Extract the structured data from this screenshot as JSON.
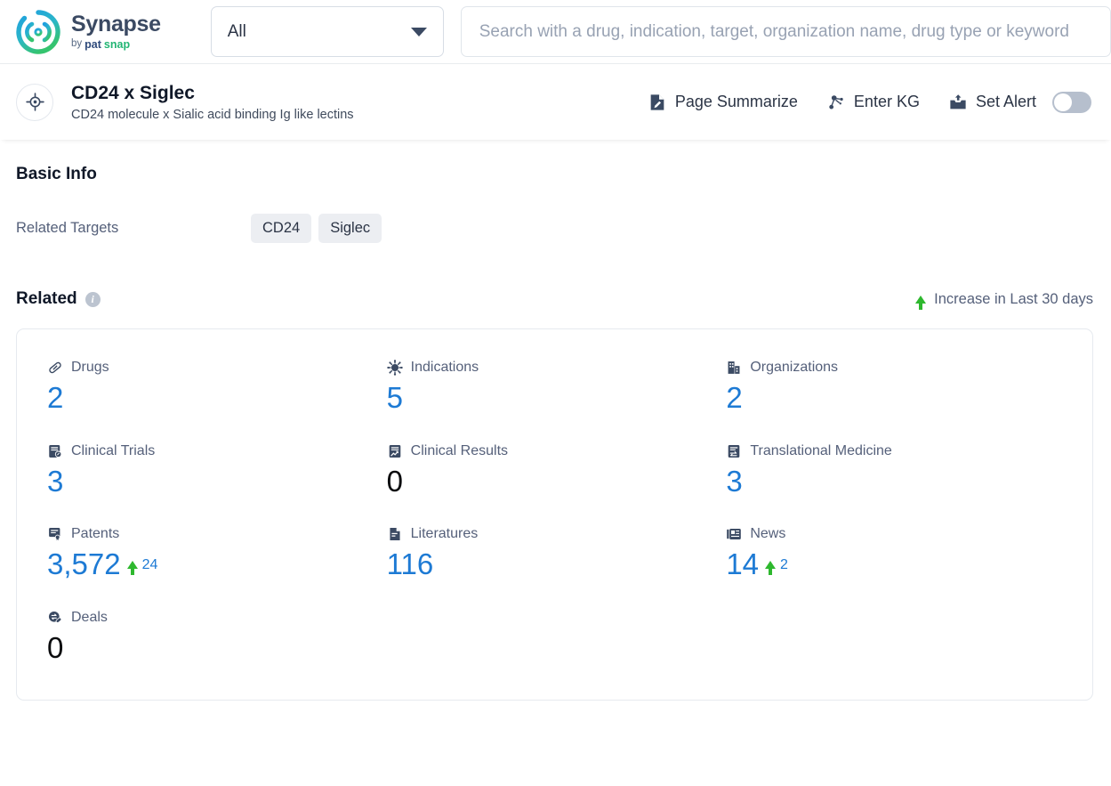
{
  "header": {
    "brand_name": "Synapse",
    "brand_by": "by",
    "brand_pat": "pat",
    "brand_snap": "snap",
    "scope_value": "All",
    "search_placeholder": "Search with a drug, indication, target, organization name, drug type or keyword",
    "search_value": ""
  },
  "entity": {
    "title": "CD24 x Siglec",
    "subtitle": "CD24 molecule x Sialic acid binding Ig like lectins",
    "icon": "target-icon"
  },
  "actions": [
    {
      "label": "Page Summarize",
      "icon": "page-summarize-icon"
    },
    {
      "label": "Enter KG",
      "icon": "knowledge-graph-icon"
    },
    {
      "label": "Set Alert",
      "icon": "alert-inbox-icon",
      "toggle_on": false
    }
  ],
  "basic_info": {
    "section_title": "Basic Info",
    "related_targets_label": "Related Targets",
    "targets": [
      "CD24",
      "Siglec"
    ]
  },
  "related": {
    "section_title": "Related",
    "info_glyph": "i",
    "legend_label": "Increase in Last 30 days",
    "legend_arrow_color": "#2eb82e",
    "accent_color": "#1d7ad4",
    "stats": [
      {
        "label": "Drugs",
        "icon": "pill-icon",
        "value": "2",
        "is_zero": false,
        "delta": null
      },
      {
        "label": "Indications",
        "icon": "virus-icon",
        "value": "5",
        "is_zero": false,
        "delta": null
      },
      {
        "label": "Organizations",
        "icon": "building-icon",
        "value": "2",
        "is_zero": false,
        "delta": null
      },
      {
        "label": "Clinical Trials",
        "icon": "clinical-trial-icon",
        "value": "3",
        "is_zero": false,
        "delta": null
      },
      {
        "label": "Clinical Results",
        "icon": "clinical-result-icon",
        "value": "0",
        "is_zero": true,
        "delta": null
      },
      {
        "label": "Translational Medicine",
        "icon": "translational-icon",
        "value": "3",
        "is_zero": false,
        "delta": null
      },
      {
        "label": "Patents",
        "icon": "patent-icon",
        "value": "3,572",
        "is_zero": false,
        "delta": "24"
      },
      {
        "label": "Literatures",
        "icon": "literature-icon",
        "value": "116",
        "is_zero": false,
        "delta": null
      },
      {
        "label": "News",
        "icon": "news-icon",
        "value": "14",
        "is_zero": false,
        "delta": "2"
      },
      {
        "label": "Deals",
        "icon": "deals-icon",
        "value": "0",
        "is_zero": true,
        "delta": null
      }
    ]
  }
}
